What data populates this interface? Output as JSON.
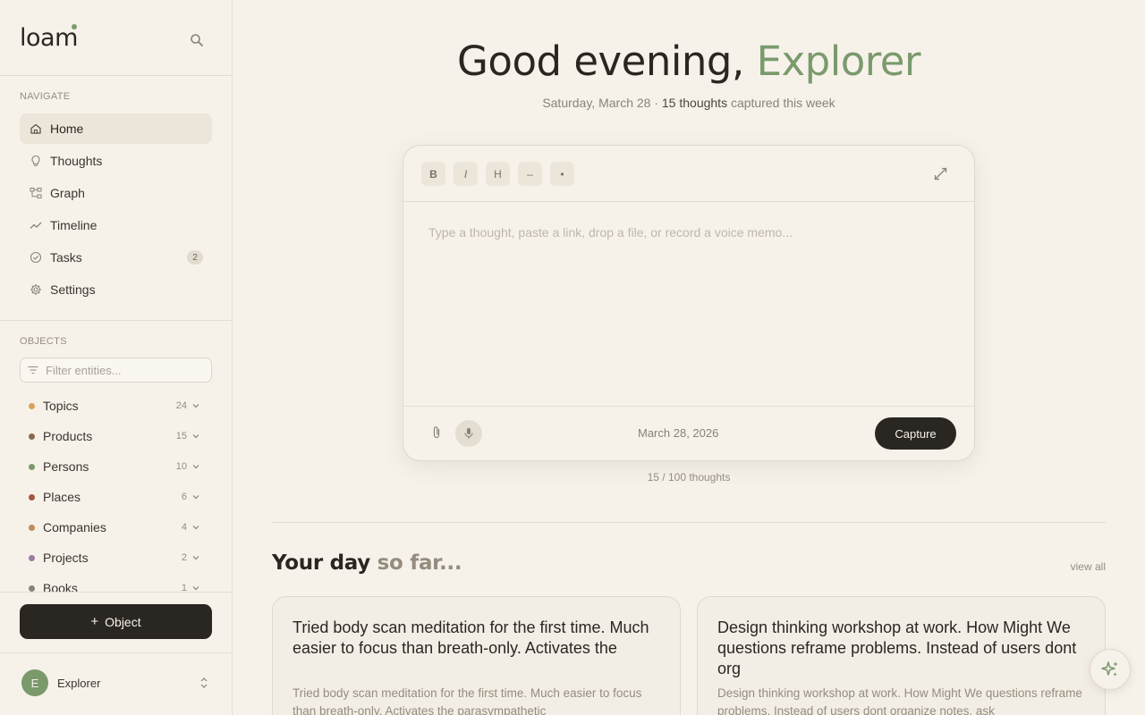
{
  "brand": {
    "name": "loam",
    "accent": "#7a9a6c"
  },
  "sidebar": {
    "nav_label": "NAVIGATE",
    "nav": [
      {
        "label": "Home",
        "icon": "home-icon",
        "active": true
      },
      {
        "label": "Thoughts",
        "icon": "lightbulb-icon"
      },
      {
        "label": "Graph",
        "icon": "graph-icon"
      },
      {
        "label": "Timeline",
        "icon": "timeline-icon"
      },
      {
        "label": "Tasks",
        "icon": "check-circle-icon",
        "badge": "2"
      },
      {
        "label": "Settings",
        "icon": "gear-icon"
      }
    ],
    "objects_label": "OBJECTS",
    "filter_placeholder": "Filter entities...",
    "objects": [
      {
        "label": "Topics",
        "count": "24",
        "color": "#d9a25a"
      },
      {
        "label": "Products",
        "count": "15",
        "color": "#8a6a4e"
      },
      {
        "label": "Persons",
        "count": "10",
        "color": "#7a9a6c"
      },
      {
        "label": "Places",
        "count": "6",
        "color": "#a3563c"
      },
      {
        "label": "Companies",
        "count": "4",
        "color": "#c08a5a"
      },
      {
        "label": "Projects",
        "count": "2",
        "color": "#9a7aa8"
      },
      {
        "label": "Books",
        "count": "1",
        "color": "#8a8276"
      }
    ],
    "add_button": "Object",
    "user": {
      "initial": "E",
      "name": "Explorer"
    }
  },
  "main": {
    "greeting_prefix": "Good evening, ",
    "greeting_name": "Explorer",
    "date_line": "Saturday, March 28 · ",
    "thought_count": "15 thoughts",
    "date_suffix": " captured this week",
    "editor": {
      "tools": [
        "B",
        "I",
        "H",
        "–",
        "•"
      ],
      "placeholder": "Type a thought, paste a link, drop a file, or record a voice memo...",
      "date": "March 28, 2026",
      "capture": "Capture"
    },
    "quota": "15 / 100 thoughts",
    "day_title_main": "Your day ",
    "day_title_muted": "so far...",
    "view_all": "view all",
    "cards": [
      {
        "title": "Tried body scan meditation for the first time. Much easier to focus than breath-only. Activates the",
        "excerpt": "Tried body scan meditation for the first time. Much easier to focus than breath-only. Activates the parasympathetic"
      },
      {
        "title": "Design thinking workshop at work. How Might We questions reframe problems. Instead of users dont org",
        "excerpt": "Design thinking workshop at work. How Might We questions reframe problems. Instead of users dont organize notes, ask"
      }
    ]
  }
}
